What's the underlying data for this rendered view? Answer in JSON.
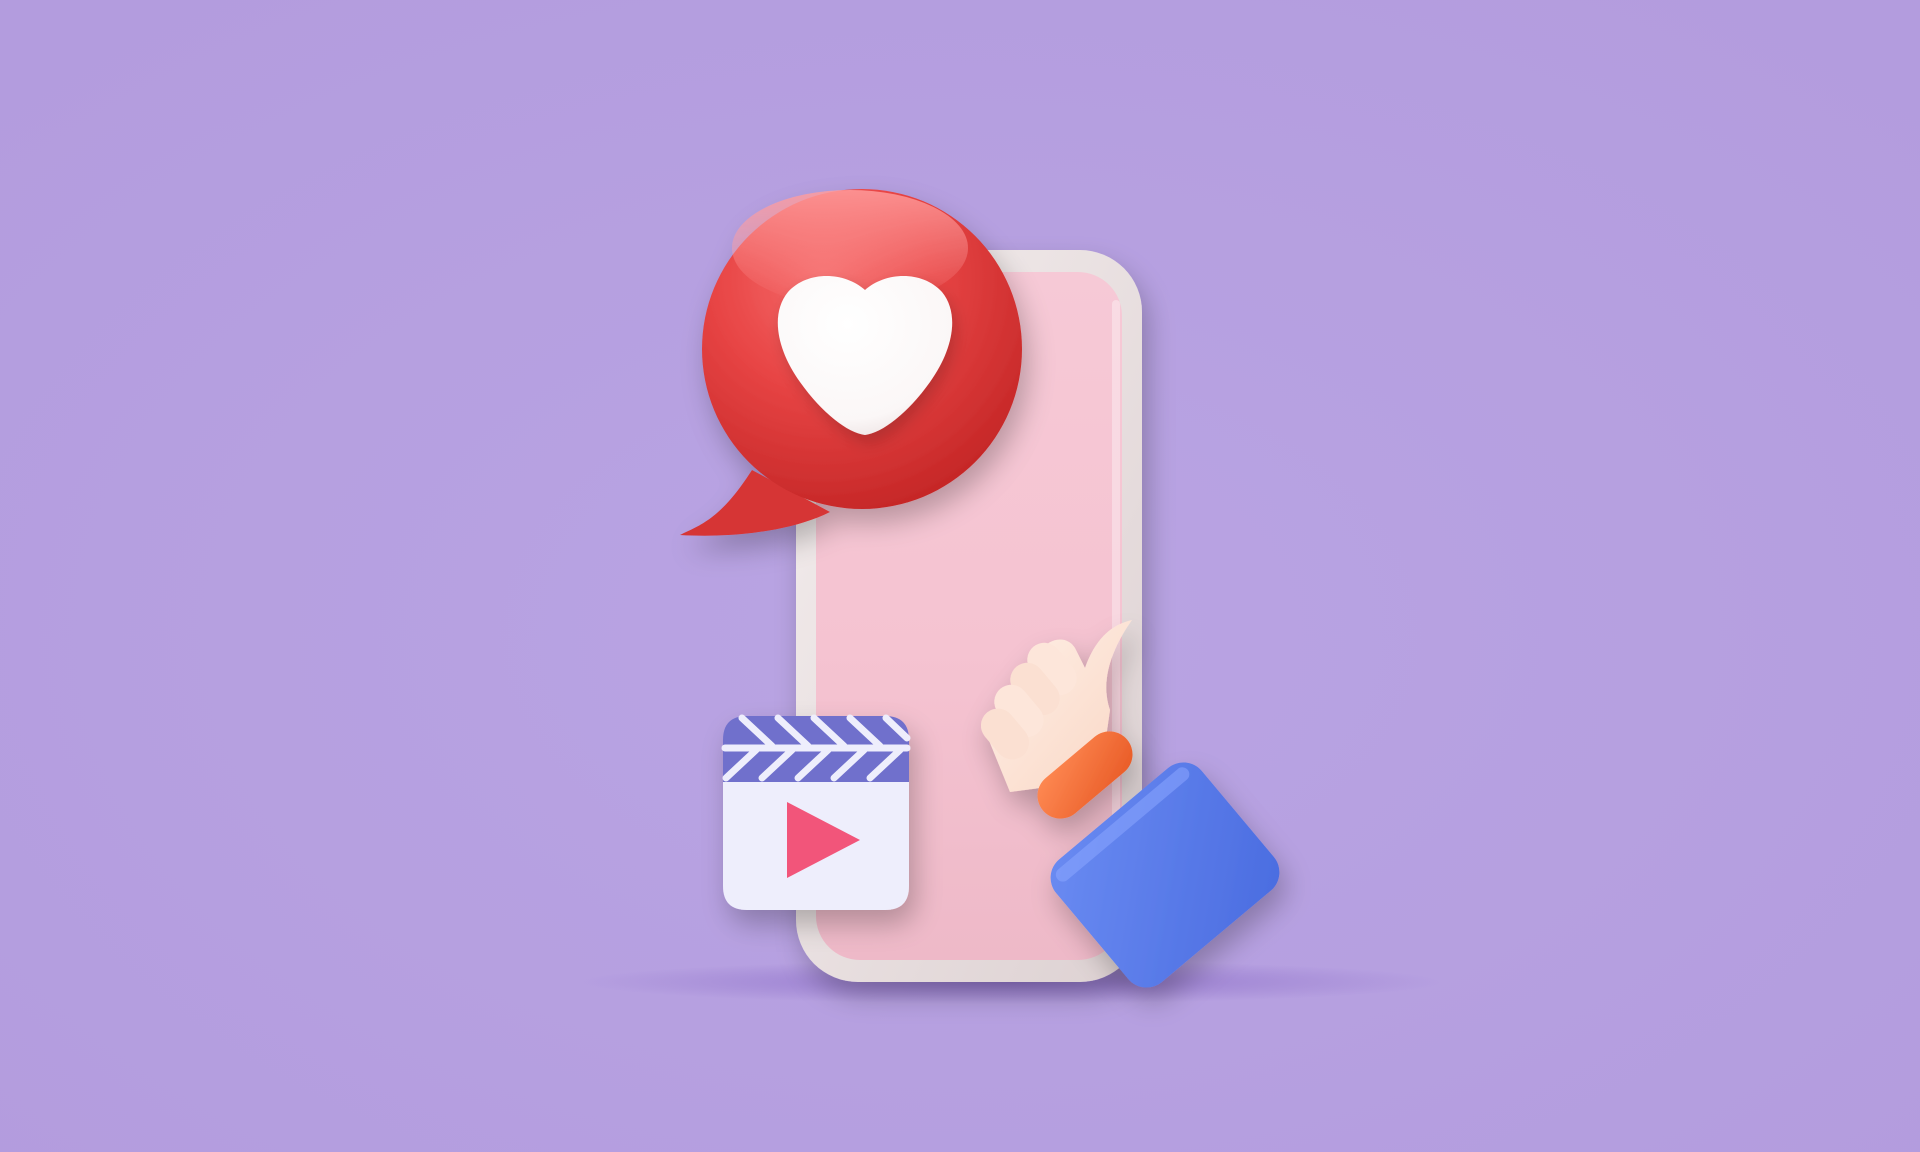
{
  "scene": {
    "colors": {
      "background": "#b6a0e0",
      "phone_frame": "#ece4e4",
      "phone_screen": "#f3c4d2",
      "bubble": "#e84444",
      "heart": "#ffffff",
      "clapper_stripe": "#6f70cc",
      "clapper_body": "#eeeefc",
      "play": "#f2557a",
      "hand": "#fde0d0",
      "cuff": "#f26a35",
      "sleeve": "#5578e8"
    },
    "icons": [
      "smartphone-icon",
      "speech-bubble-heart-icon",
      "clapperboard-play-icon",
      "thumbs-up-hand-icon"
    ]
  }
}
